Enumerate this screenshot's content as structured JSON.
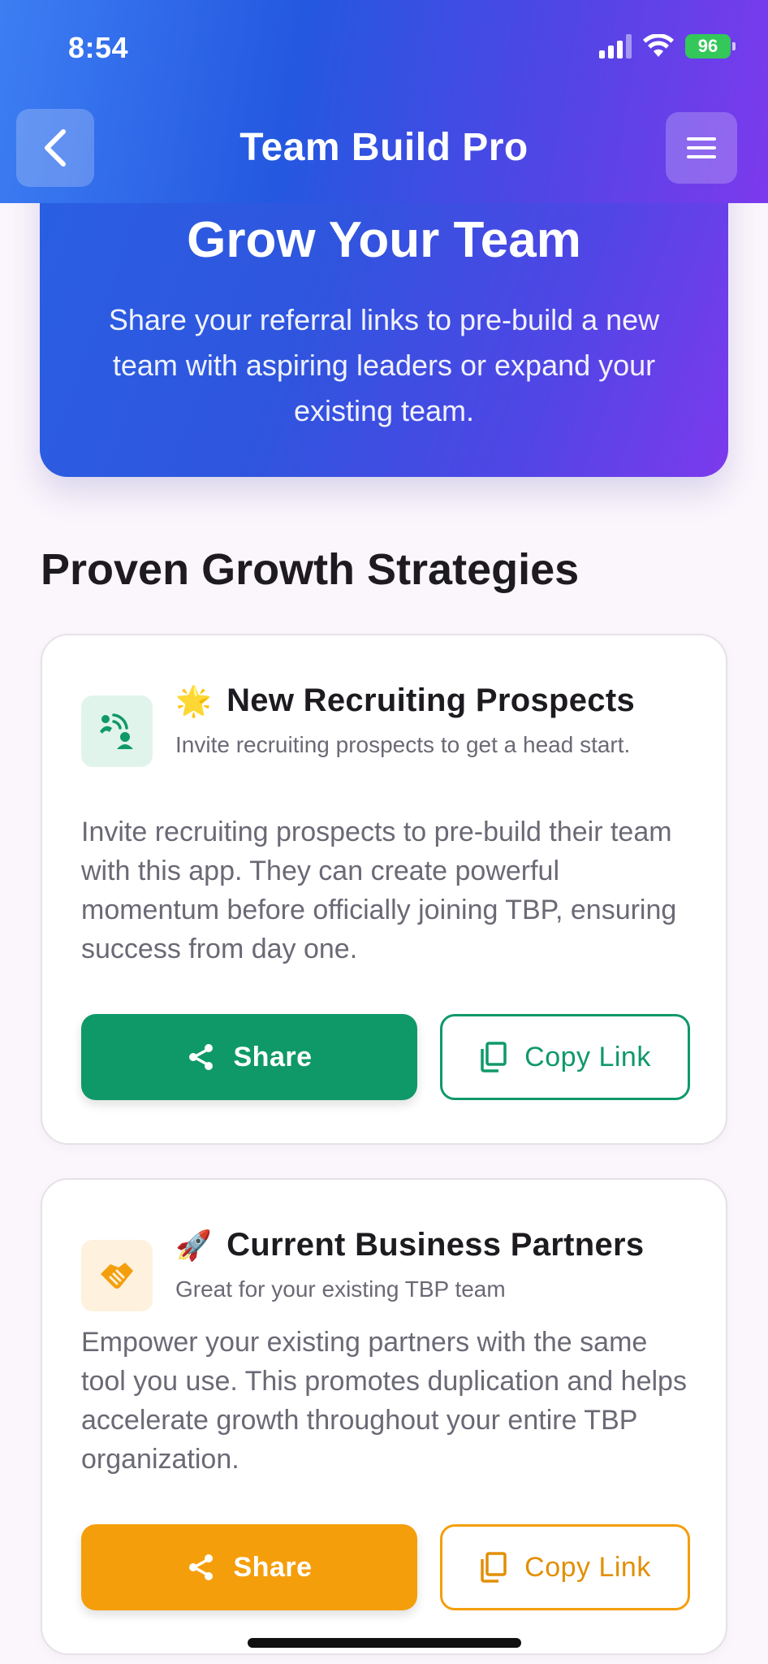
{
  "status_bar": {
    "time": "8:54",
    "battery": "96"
  },
  "app_bar": {
    "title": "Team Build Pro",
    "back_icon": "chevron-left-icon",
    "menu_icon": "hamburger-menu-icon"
  },
  "hero": {
    "title": "Grow Your Team",
    "text": "Share your referral links to pre-build a new team with aspiring leaders or expand your existing team."
  },
  "section": {
    "title": "Proven Growth Strategies"
  },
  "cards": [
    {
      "emoji": "🌟",
      "title": "New Recruiting Prospects",
      "subtitle": "Invite recruiting prospects to get a head start.",
      "body": "Invite recruiting prospects to pre-build their team with this app. They can create powerful momentum before officially joining TBP, ensuring success from day one.",
      "icon": "person-add-waves-icon",
      "accent": "#0f9968",
      "share_label": "Share",
      "copy_label": "Copy Link"
    },
    {
      "emoji": "🚀",
      "title": "Current Business Partners",
      "subtitle": "Great for your existing TBP team",
      "body": "Empower your existing partners with the same tool you use. This promotes duplication and helps accelerate growth throughout your entire TBP organization.",
      "icon": "handshake-icon",
      "accent": "#f59e0b",
      "share_label": "Share",
      "copy_label": "Copy Link"
    }
  ]
}
